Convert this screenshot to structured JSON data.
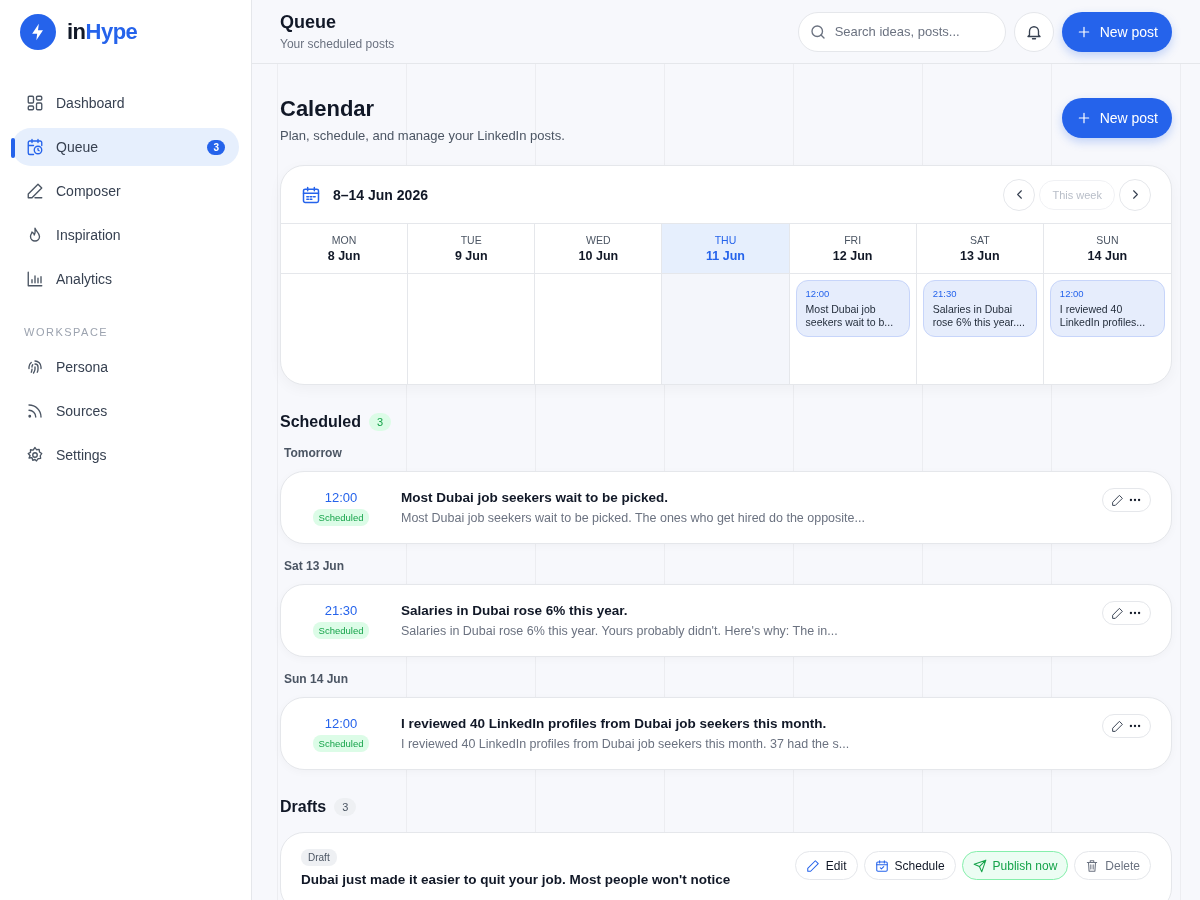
{
  "brand": {
    "name_dark": "in",
    "name_accent": "Hype"
  },
  "nav": [
    {
      "kind": "dashboard",
      "label": "Dashboard",
      "selected": false
    },
    {
      "kind": "queue",
      "label": "Queue",
      "selected": true,
      "badge": "3"
    },
    {
      "kind": "composer",
      "label": "Composer",
      "selected": false
    },
    {
      "kind": "inspiration",
      "label": "Inspiration",
      "selected": false
    },
    {
      "kind": "analytics",
      "label": "Analytics",
      "selected": false
    }
  ],
  "workspace": {
    "label": "WORKSPACE",
    "items": [
      {
        "kind": "persona",
        "label": "Persona",
        "selected": false
      },
      {
        "kind": "sources",
        "label": "Sources",
        "selected": false
      },
      {
        "kind": "settings",
        "label": "Settings",
        "selected": false
      }
    ]
  },
  "topbar": {
    "title": "Queue",
    "subtitle": "Your scheduled posts",
    "search": {
      "placeholder": "Search ideas, posts..."
    },
    "new_post": "New post"
  },
  "page": {
    "title": "Calendar",
    "subtitle": "Plan, schedule, and manage your LinkedIn posts.",
    "new_post": "New post"
  },
  "calendar": {
    "range": "8–14 Jun 2026",
    "this_week": "This week",
    "this_week_disabled": true,
    "days": [
      {
        "weekday": "MON",
        "date": "8 Jun",
        "today": false
      },
      {
        "weekday": "TUE",
        "date": "9 Jun",
        "today": false
      },
      {
        "weekday": "WED",
        "date": "10 Jun",
        "today": false
      },
      {
        "weekday": "THU",
        "date": "11 Jun",
        "today": true
      },
      {
        "weekday": "FRI",
        "date": "12 Jun",
        "today": false,
        "events": [
          {
            "time": "12:00",
            "text": "Most Dubai job seekers wait to b..."
          }
        ]
      },
      {
        "weekday": "SAT",
        "date": "13 Jun",
        "today": false,
        "events": [
          {
            "time": "21:30",
            "text": "Salaries in Dubai rose 6% this year...."
          }
        ]
      },
      {
        "weekday": "SUN",
        "date": "14 Jun",
        "today": false,
        "events": [
          {
            "time": "12:00",
            "text": "I reviewed 40 LinkedIn profiles..."
          }
        ]
      }
    ]
  },
  "scheduled": {
    "title": "Scheduled",
    "count": "3",
    "groups": [
      {
        "label": "Tomorrow",
        "posts": [
          {
            "time": "12:00",
            "status": "Scheduled",
            "title": "Most Dubai job seekers wait to be picked.",
            "excerpt": "Most Dubai job seekers wait to be picked. The ones who get hired do the opposite..."
          }
        ]
      },
      {
        "label": "Sat 13 Jun",
        "posts": [
          {
            "time": "21:30",
            "status": "Scheduled",
            "title": "Salaries in Dubai rose 6% this year.",
            "excerpt": "Salaries in Dubai rose 6% this year. Yours probably didn't. Here's why: The in..."
          }
        ]
      },
      {
        "label": "Sun 14 Jun",
        "posts": [
          {
            "time": "12:00",
            "status": "Scheduled",
            "title": "I reviewed 40 LinkedIn profiles from Dubai job seekers this month.",
            "excerpt": "I reviewed 40 LinkedIn profiles from Dubai job seekers this month. 37 had the s..."
          }
        ]
      }
    ]
  },
  "drafts": {
    "title": "Drafts",
    "count": "3",
    "cards": [
      {
        "tag": "Draft",
        "title": "Dubai just made it easier to quit your job. Most people won't notice",
        "actions": [
          {
            "kind": "edit",
            "label": "Edit"
          },
          {
            "kind": "schedule",
            "label": "Schedule"
          },
          {
            "kind": "publish",
            "label": "Publish now"
          },
          {
            "kind": "delete",
            "label": "Delete"
          }
        ]
      }
    ]
  }
}
